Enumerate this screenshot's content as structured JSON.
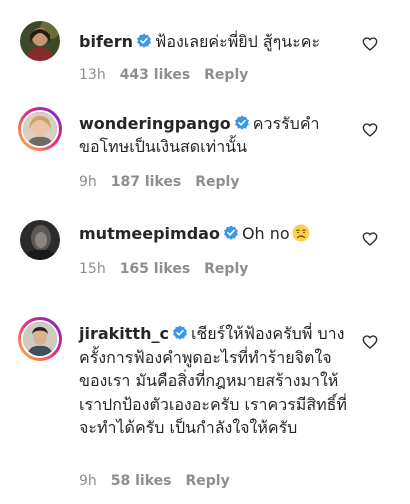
{
  "comments": [
    {
      "username": "bifern",
      "text": "ฟ้องเลยค่ะพี่ยิป สู้ๆนะคะ",
      "time": "13h",
      "likes": "443 likes",
      "reply": "Reply"
    },
    {
      "username": "wonderingpango",
      "text": "ควรรับคำขอโทษเป็นเงินสดเท่านั้น",
      "time": "9h",
      "likes": "187 likes",
      "reply": "Reply"
    },
    {
      "username": "mutmeepimdao",
      "text": "Oh no",
      "emoji": "disappointed-face-emoji",
      "time": "15h",
      "likes": "165 likes",
      "reply": "Reply"
    },
    {
      "username": "jirakitth_c",
      "text": "เชียร์ให้ฟ้องครับพี่ บางครั้งการฟ้องคำพูดอะไรที่ทำร้ายจิตใจของเรา มันคือสิ่งที่กฎหมายสร้างมาให้เราปกป้องตัวเองอะครับ เราควรมีสิทธิ์ที่จะทำได้ครับ เป็นกำลังใจให้ครับ",
      "time": "9h",
      "likes": "58 likes",
      "reply": "Reply"
    }
  ],
  "icons": {
    "verified": "verified-badge-icon",
    "like": "heart-outline-icon"
  },
  "colors": {
    "verified_blue": "#3897f0",
    "meta_gray": "#8e8e8e",
    "text": "#262626"
  }
}
